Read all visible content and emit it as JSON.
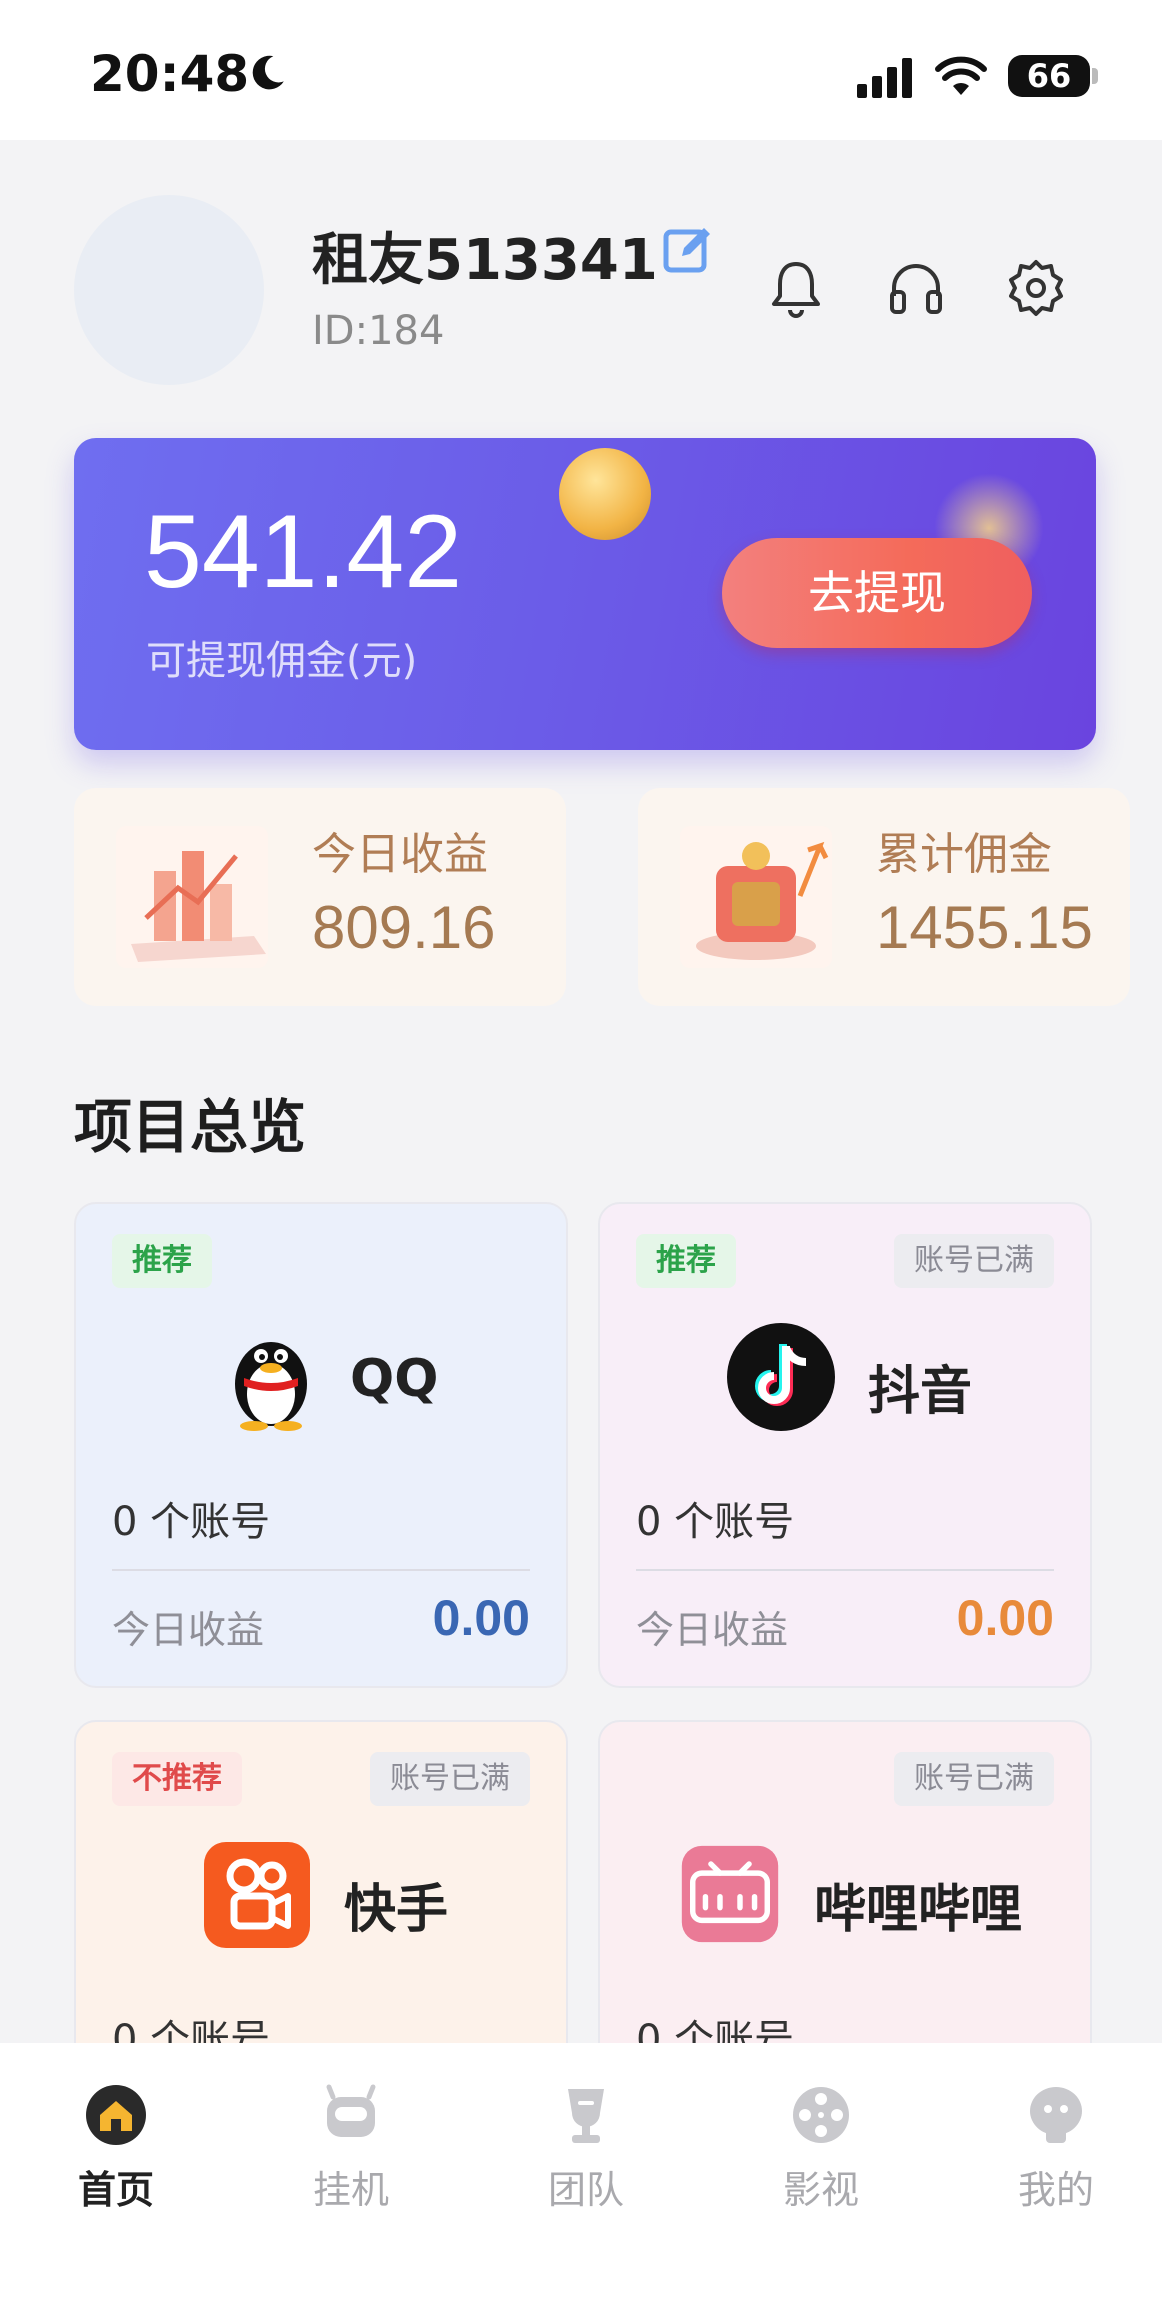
{
  "status_bar": {
    "time": "20:48",
    "battery": "66"
  },
  "profile": {
    "username": "租友513341",
    "id": "ID:184"
  },
  "balance": {
    "amount": "541.42",
    "label": "可提现佣金(元)",
    "withdraw_label": "去提现"
  },
  "stats": [
    {
      "title": "今日收益",
      "value": "809.16"
    },
    {
      "title": "累计佣金",
      "value": "1455.15"
    }
  ],
  "section_title": "项目总览",
  "projects": [
    {
      "name": "QQ",
      "badge": "推荐",
      "full_badge": "",
      "accounts": "0 个账号",
      "today_label": "今日收益",
      "today_value": "0.00",
      "value_color": "#3a67b3",
      "bg": "#ebf0fb"
    },
    {
      "name": "抖音",
      "badge": "推荐",
      "full_badge": "账号已满",
      "accounts": "0 个账号",
      "today_label": "今日收益",
      "today_value": "0.00",
      "value_color": "#e88a3a",
      "bg": "#f8eef8"
    },
    {
      "name": "快手",
      "badge": "不推荐",
      "full_badge": "账号已满",
      "accounts": "0 个账号",
      "bg": "#fdf2ea"
    },
    {
      "name": "哔哩哔哩",
      "badge": "",
      "full_badge": "账号已满",
      "accounts": "0 个账号",
      "bg": "#fbeef2"
    }
  ],
  "tabs": [
    {
      "label": "首页",
      "icon": "home-icon",
      "active": true
    },
    {
      "label": "挂机",
      "icon": "robot-icon",
      "active": false
    },
    {
      "label": "团队",
      "icon": "trophy-icon",
      "active": false
    },
    {
      "label": "影视",
      "icon": "film-reel-icon",
      "active": false
    },
    {
      "label": "我的",
      "icon": "profile-icon",
      "active": false
    }
  ]
}
